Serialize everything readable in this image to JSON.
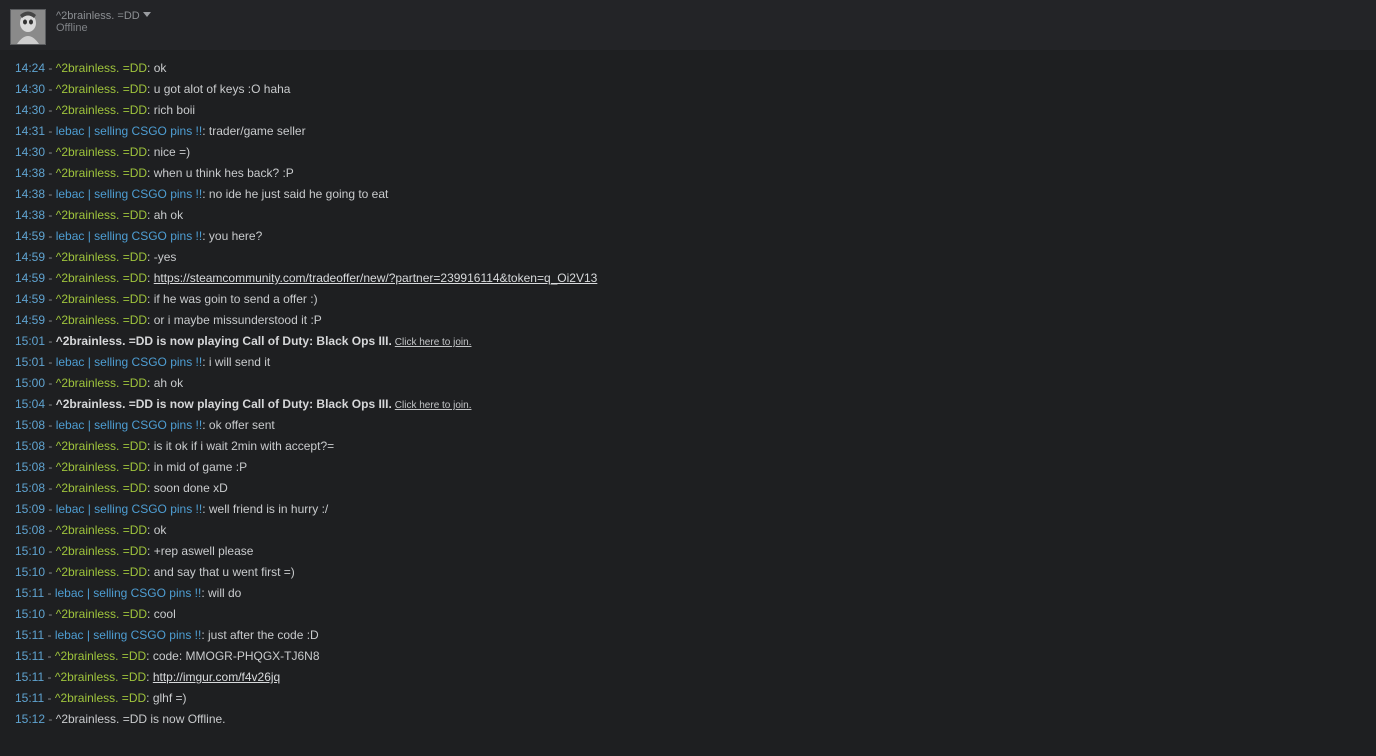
{
  "header": {
    "name": "^2brainless. =DD",
    "status": "Offline"
  },
  "messages": [
    {
      "time": "14:24",
      "sender": "^2brainless. =DD",
      "who": "a",
      "text": "ok"
    },
    {
      "time": "14:30",
      "sender": "^2brainless. =DD",
      "who": "a",
      "text": "u got alot of keys :O haha"
    },
    {
      "time": "14:30",
      "sender": "^2brainless. =DD",
      "who": "a",
      "text": "rich boii"
    },
    {
      "time": "14:31",
      "sender": "lebac | selling CSGO pins !!",
      "who": "b",
      "text": "trader/game seller"
    },
    {
      "time": "14:30",
      "sender": "^2brainless. =DD",
      "who": "a",
      "text": "nice =)"
    },
    {
      "time": "14:38",
      "sender": "^2brainless. =DD",
      "who": "a",
      "text": "when u think hes back? :P"
    },
    {
      "time": "14:38",
      "sender": "lebac | selling CSGO pins !!",
      "who": "b",
      "text": "no ide he just said he going to eat"
    },
    {
      "time": "14:38",
      "sender": "^2brainless. =DD",
      "who": "a",
      "text": "ah ok"
    },
    {
      "time": "14:59",
      "sender": "lebac | selling CSGO pins !!",
      "who": "b",
      "text": "you here?"
    },
    {
      "time": "14:59",
      "sender": "^2brainless. =DD",
      "who": "a",
      "text": "-yes"
    },
    {
      "time": "14:59",
      "sender": "^2brainless. =DD",
      "who": "a",
      "text": "https://steamcommunity.com/tradeoffer/new/?partner=239916114&token=q_Oi2V13",
      "link": true
    },
    {
      "time": "14:59",
      "sender": "^2brainless. =DD",
      "who": "a",
      "text": "if he was goin to send a offer :)"
    },
    {
      "time": "14:59",
      "sender": "^2brainless. =DD",
      "who": "a",
      "text": "or i maybe missunderstood it :P"
    },
    {
      "time": "15:01",
      "event": "^2brainless. =DD is now playing Call of Duty: Black Ops III.",
      "join": "Click here to join."
    },
    {
      "time": "15:01",
      "sender": "lebac | selling CSGO pins !!",
      "who": "b",
      "text": "i will send it"
    },
    {
      "time": "15:00",
      "sender": "^2brainless. =DD",
      "who": "a",
      "text": "ah ok"
    },
    {
      "time": "15:04",
      "event": "^2brainless. =DD is now playing Call of Duty: Black Ops III.",
      "join": "Click here to join."
    },
    {
      "time": "15:08",
      "sender": "lebac | selling CSGO pins !!",
      "who": "b",
      "text": "ok offer sent"
    },
    {
      "time": "15:08",
      "sender": "^2brainless. =DD",
      "who": "a",
      "text": "is it ok if i wait 2min with accept?="
    },
    {
      "time": "15:08",
      "sender": "^2brainless. =DD",
      "who": "a",
      "text": "in mid of game :P"
    },
    {
      "time": "15:08",
      "sender": "^2brainless. =DD",
      "who": "a",
      "text": "soon done xD"
    },
    {
      "time": "15:09",
      "sender": "lebac | selling CSGO pins !!",
      "who": "b",
      "text": "well friend is in hurry :/"
    },
    {
      "time": "15:08",
      "sender": "^2brainless. =DD",
      "who": "a",
      "text": "ok"
    },
    {
      "time": "15:10",
      "sender": "^2brainless. =DD",
      "who": "a",
      "text": "+rep aswell please"
    },
    {
      "time": "15:10",
      "sender": "^2brainless. =DD",
      "who": "a",
      "text": "and say that u went first =)"
    },
    {
      "time": "15:11",
      "sender": "lebac | selling CSGO pins !!",
      "who": "b",
      "text": "will do"
    },
    {
      "time": "15:10",
      "sender": "^2brainless. =DD",
      "who": "a",
      "text": "cool"
    },
    {
      "time": "15:11",
      "sender": "lebac | selling CSGO pins !!",
      "who": "b",
      "text": "just after the code :D"
    },
    {
      "time": "15:11",
      "sender": "^2brainless. =DD",
      "who": "a",
      "text": "code: MMOGR-PHQGX-TJ6N8"
    },
    {
      "time": "15:11",
      "sender": "^2brainless. =DD",
      "who": "a",
      "text": "http://imgur.com/f4v26jq",
      "link": true
    },
    {
      "time": "15:11",
      "sender": "^2brainless. =DD",
      "who": "a",
      "text": "glhf =)"
    },
    {
      "time": "15:12",
      "offline": "^2brainless. =DD is now Offline."
    }
  ]
}
